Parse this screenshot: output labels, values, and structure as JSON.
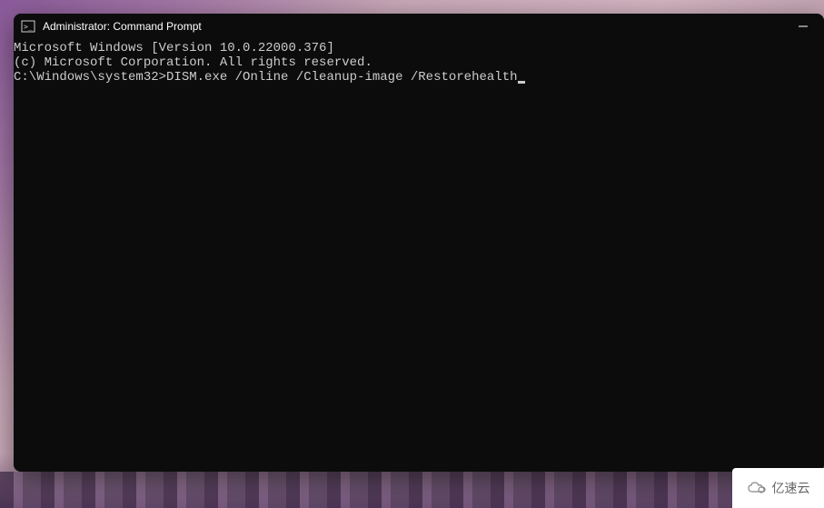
{
  "window": {
    "title": "Administrator: Command Prompt"
  },
  "terminal": {
    "line1": "Microsoft Windows [Version 10.0.22000.376]",
    "line2": "(c) Microsoft Corporation. All rights reserved.",
    "blank": "",
    "prompt": "C:\\Windows\\system32>",
    "command": "DISM.exe /Online /Cleanup-image /Restorehealth"
  },
  "watermark": {
    "text": "亿速云"
  }
}
